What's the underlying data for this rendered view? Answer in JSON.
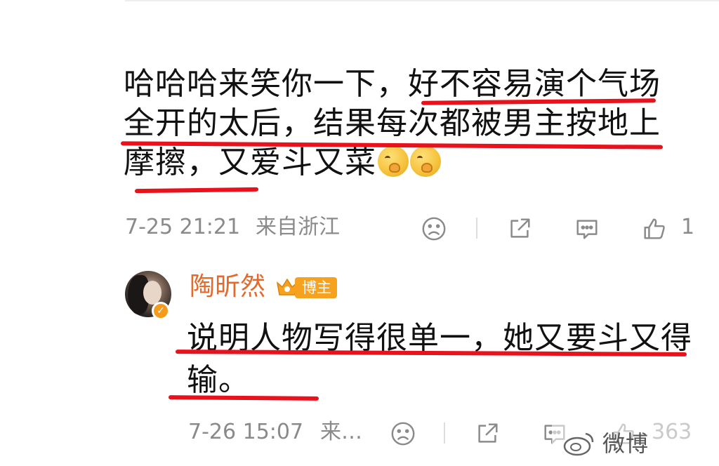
{
  "comment": {
    "text": "哈哈哈来笑你一下，好不容易演个气场全开的太后，结果每次都被男主按地上摩擦，又爱斗又菜",
    "emoji_names": [
      "laugh-cover-mouth-emoji",
      "laugh-cover-mouth-emoji"
    ],
    "time": "7-25 21:21",
    "source": "来自浙江",
    "like_count": "1",
    "actions": [
      "dislike-icon",
      "share-icon",
      "comment-icon",
      "like-icon"
    ]
  },
  "reply": {
    "username": "陶昕然",
    "badge_label": "博主",
    "text": "说明人物写得很单一，她又要斗又得输。",
    "time": "7-26 15:07",
    "source": "来…",
    "like_count": "363"
  },
  "watermark": {
    "text": "微博"
  },
  "colors": {
    "highlight_underline": "#e8121c",
    "username": "#e46a2b",
    "badge": "#f7a21f",
    "meta_gray": "#8a8a8a"
  }
}
